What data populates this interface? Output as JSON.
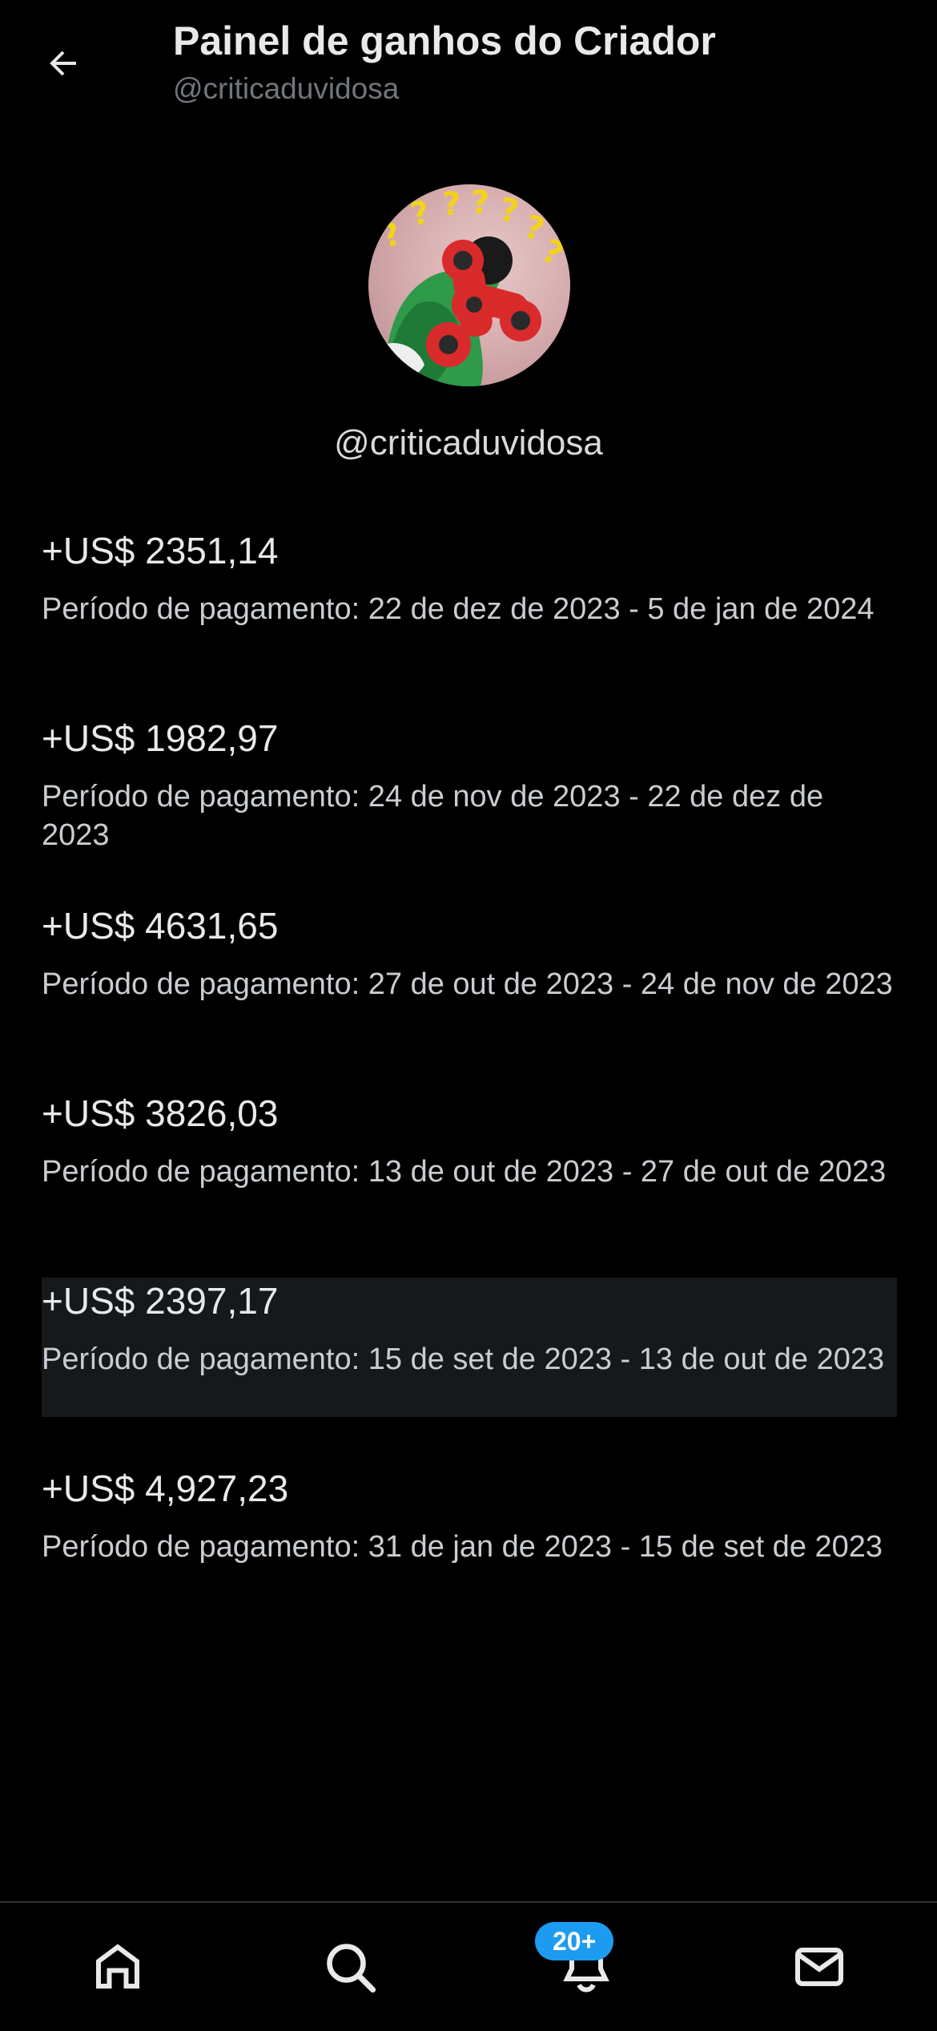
{
  "header": {
    "title": "Painel de ganhos do Criador",
    "subtitle": "@criticaduvidosa"
  },
  "profile": {
    "handle": "@criticaduvidosa"
  },
  "payouts": [
    {
      "amount": "+US$ 2351,14",
      "period": "Período de pagamento: 22 de dez de 2023 - 5 de jan de 2024"
    },
    {
      "amount": "+US$ 1982,97",
      "period": "Período de pagamento: 24 de nov de 2023 - 22 de dez de 2023"
    },
    {
      "amount": "+US$ 4631,65",
      "period": "Período de pagamento: 27 de out de 2023 - 24 de nov de 2023"
    },
    {
      "amount": "+US$ 3826,03",
      "period": "Período de pagamento: 13 de out de 2023 - 27 de out de 2023"
    },
    {
      "amount": "+US$ 2397,17",
      "period": "Período de pagamento: 15 de set de 2023 - 13 de out de 2023"
    },
    {
      "amount": "+US$ 4,927,23",
      "period": "Período de pagamento: 31 de jan de 2023 - 15 de set de 2023"
    }
  ],
  "nav": {
    "items": [
      "home-icon",
      "search-icon",
      "bell-icon",
      "mail-icon"
    ],
    "notifications_badge": "20+"
  },
  "colors": {
    "background": "#000000",
    "text": "#e7e9ea",
    "muted": "#71767b",
    "accent": "#1d9bf0",
    "highlight_row": "#16181c"
  }
}
